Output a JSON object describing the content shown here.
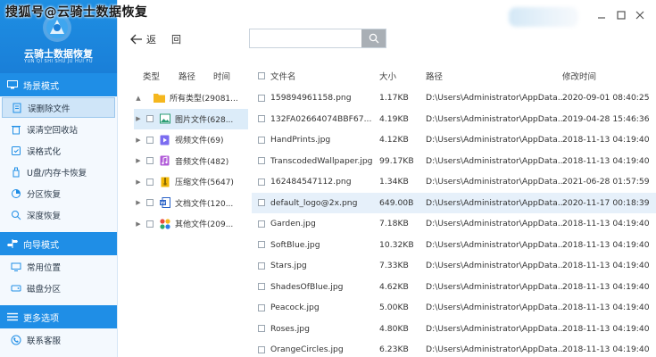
{
  "overlay_title": "搜狐号@云骑士数据恢复",
  "logo": {
    "name": "云骑士数据恢复",
    "sub": "YUN QI SHI SHU JU HUI FU"
  },
  "sidebar": {
    "sections": [
      {
        "title": "场景模式",
        "items": [
          "误删除文件",
          "误清空回收站",
          "误格式化",
          "U盘/内存卡恢复",
          "分区恢复",
          "深度恢复"
        ]
      },
      {
        "title": "向导模式",
        "items": [
          "常用位置",
          "磁盘分区"
        ]
      },
      {
        "title": "更多选项",
        "items": [
          "联系客服"
        ]
      }
    ],
    "active_item": "误删除文件"
  },
  "toolbar": {
    "back_label": "返",
    "home_label": "回",
    "search_value": ""
  },
  "tree": {
    "headers": [
      "类型",
      "路径",
      "时间"
    ],
    "items": [
      {
        "label": "所有类型(29081...",
        "arrow": "▲"
      },
      {
        "label": "图片文件(628...",
        "arrow": "▶"
      },
      {
        "label": "视频文件(69)",
        "arrow": "▶"
      },
      {
        "label": "音频文件(482)",
        "arrow": "▶"
      },
      {
        "label": "压缩文件(5647)",
        "arrow": "▶"
      },
      {
        "label": "文档文件(120...",
        "arrow": "▶"
      },
      {
        "label": "其他文件(209...",
        "arrow": "▶"
      }
    ]
  },
  "table": {
    "headers": {
      "name": "文件名",
      "size": "大小",
      "path": "路径",
      "time": "修改时间"
    },
    "rows": [
      {
        "name": "159894961158.png",
        "size": "1.17KB",
        "path": "D:\\Users\\Administrator\\AppData...",
        "time": "2020-09-01 08:40:25"
      },
      {
        "name": "132FA02664074BBF67...",
        "size": "4.19KB",
        "path": "D:\\Users\\Administrator\\AppData...",
        "time": "2019-04-28 15:46:36"
      },
      {
        "name": "HandPrints.jpg",
        "size": "4.12KB",
        "path": "D:\\Users\\Administrator\\AppData...",
        "time": "2018-11-13 04:19:40"
      },
      {
        "name": "TranscodedWallpaper.jpg",
        "size": "99.17KB",
        "path": "D:\\Users\\Administrator\\AppData...",
        "time": "2018-11-13 04:19:40"
      },
      {
        "name": "162484547112.png",
        "size": "1.34KB",
        "path": "D:\\Users\\Administrator\\AppData...",
        "time": "2021-06-28 01:57:59"
      },
      {
        "name": "default_logo@2x.png",
        "size": "649.00B",
        "path": "D:\\Users\\Administrator\\AppData...",
        "time": "2020-11-17 00:18:39"
      },
      {
        "name": "Garden.jpg",
        "size": "7.18KB",
        "path": "D:\\Users\\Administrator\\AppData...",
        "time": "2018-11-13 04:19:40"
      },
      {
        "name": "SoftBlue.jpg",
        "size": "10.32KB",
        "path": "D:\\Users\\Administrator\\AppData...",
        "time": "2018-11-13 04:19:40"
      },
      {
        "name": "Stars.jpg",
        "size": "7.33KB",
        "path": "D:\\Users\\Administrator\\AppData...",
        "time": "2018-11-13 04:19:40"
      },
      {
        "name": "ShadesOfBlue.jpg",
        "size": "4.62KB",
        "path": "D:\\Users\\Administrator\\AppData...",
        "time": "2018-11-13 04:19:40"
      },
      {
        "name": "Peacock.jpg",
        "size": "5.00KB",
        "path": "D:\\Users\\Administrator\\AppData...",
        "time": "2018-11-13 04:19:40"
      },
      {
        "name": "Roses.jpg",
        "size": "4.80KB",
        "path": "D:\\Users\\Administrator\\AppData...",
        "time": "2018-11-13 04:19:40"
      },
      {
        "name": "OrangeCircles.jpg",
        "size": "6.23KB",
        "path": "D:\\Users\\Administrator\\AppData...",
        "time": "2018-11-13 04:19:40"
      }
    ]
  },
  "colors": {
    "brand": "#1f8ee6",
    "active_bg": "#cfe5f8",
    "hover_row": "#e6f0fa",
    "sidebar_bg": "#f4f9fe"
  }
}
